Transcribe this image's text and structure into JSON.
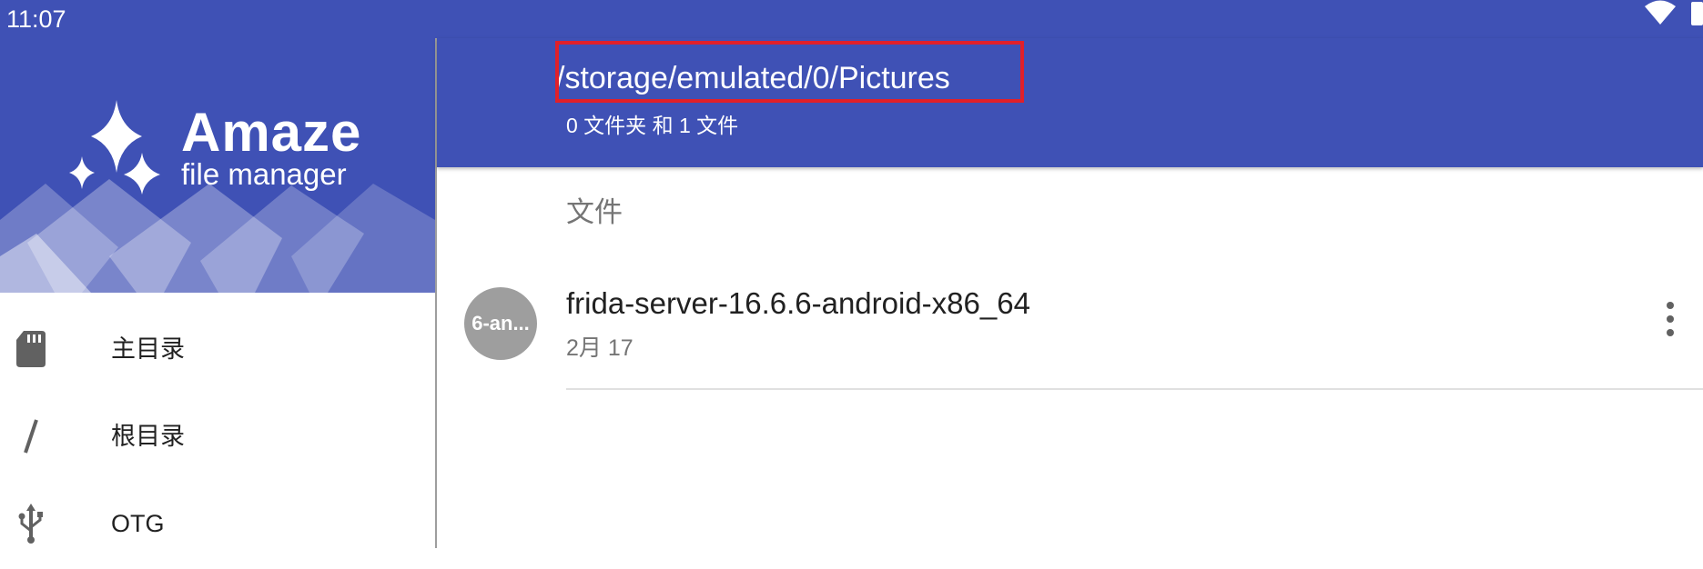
{
  "status_bar": {
    "time": "11:07",
    "icons": [
      "wifi-icon",
      "battery-icon"
    ]
  },
  "drawer": {
    "logo": {
      "title": "Amaze",
      "subtitle": "file manager"
    },
    "items": [
      {
        "label": "主目录",
        "icon": "sd-card-icon"
      },
      {
        "label": "根目录",
        "icon": "slash-icon"
      },
      {
        "label": "OTG",
        "icon": "usb-icon"
      }
    ]
  },
  "appbar": {
    "path": "/storage/emulated/0/Pictures",
    "summary": "0 文件夹 和 1 文件"
  },
  "content": {
    "section_header": "文件",
    "files": [
      {
        "thumb_text": "6-an...",
        "name": "frida-server-16.6.6-android-x86_64",
        "date": "2月 17",
        "menu_icon": "more-vert-icon"
      }
    ]
  },
  "colors": {
    "primary": "#3f51b5",
    "highlight": "#e0202a",
    "thumb": "#9e9e9e"
  }
}
